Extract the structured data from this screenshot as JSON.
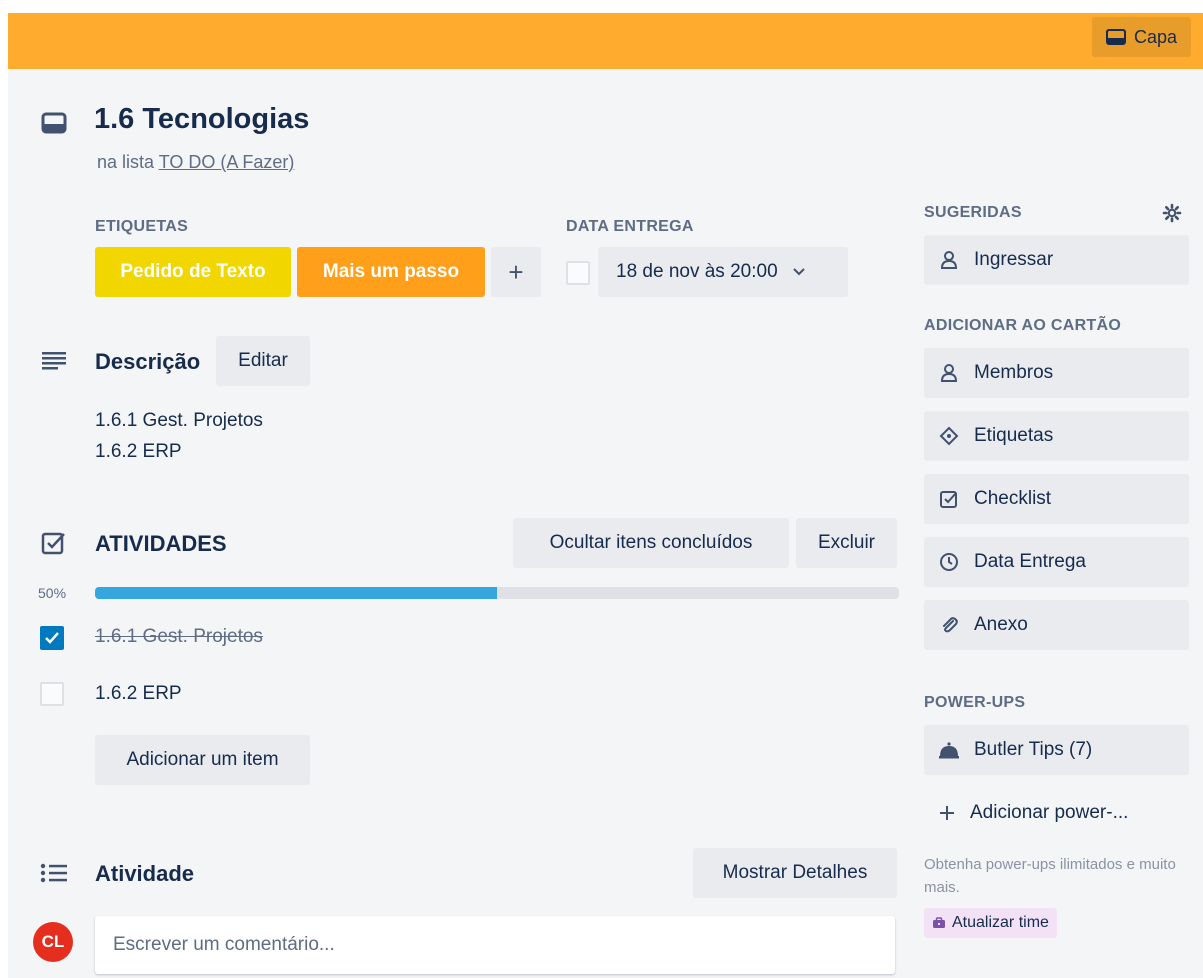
{
  "cover": {
    "label": "Capa"
  },
  "card": {
    "title": "1.6 Tecnologias",
    "list_prefix": "na lista",
    "list_name": "TO DO (A Fazer)"
  },
  "labels": {
    "heading": "ETIQUETAS",
    "items": [
      {
        "text": "Pedido de Texto",
        "color": "#f2d600"
      },
      {
        "text": "Mais um passo",
        "color": "#ff9f1a"
      }
    ],
    "add_label": "+"
  },
  "due": {
    "heading": "DATA ENTREGA",
    "value": "18 de nov às 20:00"
  },
  "description": {
    "heading": "Descrição",
    "edit_label": "Editar",
    "lines": [
      "1.6.1 Gest. Projetos",
      "1.6.2 ERP"
    ]
  },
  "checklist": {
    "title": "ATIVIDADES",
    "hide_label": "Ocultar itens concluídos",
    "delete_label": "Excluir",
    "progress_text": "50%",
    "progress": 0.5,
    "items": [
      {
        "text": "1.6.1 Gest. Projetos",
        "checked": true
      },
      {
        "text": "1.6.2 ERP",
        "checked": false
      }
    ],
    "add_item_label": "Adicionar um item"
  },
  "activity": {
    "heading": "Atividade",
    "details_label": "Mostrar Detalhes",
    "avatar_initials": "CL",
    "comment_placeholder": "Escrever um comentário..."
  },
  "sidebar": {
    "suggested_heading": "SUGERIDAS",
    "join_label": "Ingressar",
    "add_heading": "ADICIONAR AO CARTÃO",
    "add_items": [
      {
        "label": "Membros",
        "icon": "person-icon"
      },
      {
        "label": "Etiquetas",
        "icon": "tag-icon"
      },
      {
        "label": "Checklist",
        "icon": "checkbox-icon"
      },
      {
        "label": "Data Entrega",
        "icon": "clock-icon"
      },
      {
        "label": "Anexo",
        "icon": "paperclip-icon"
      }
    ],
    "powerups_heading": "POWER-UPS",
    "butler_label": "Butler Tips (7)",
    "add_powerup_label": "Adicionar power-...",
    "note": "Obtenha power-ups ilimitados e muito mais.",
    "upgrade_label": "Atualizar time"
  },
  "colors": {
    "cover": "#ffab2e",
    "progress": "#36a6de",
    "checkbox_checked": "#0079bf",
    "avatar": "#e52e1e"
  }
}
